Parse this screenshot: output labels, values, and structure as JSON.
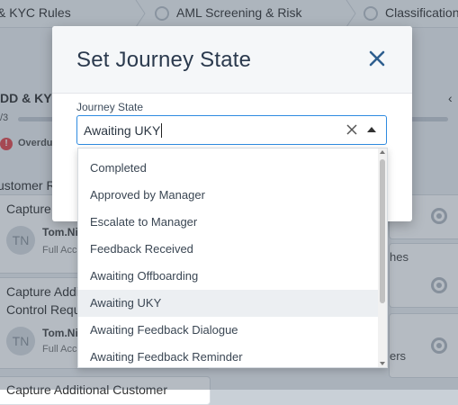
{
  "steps": [
    {
      "label": "& KYC Rules"
    },
    {
      "label": "AML Screening & Risk"
    },
    {
      "label": "Classification"
    }
  ],
  "background": {
    "section_title": "DD & KYC",
    "progress_text": "/3",
    "overdue_label": "Overdue",
    "group_title": "ustomer R",
    "cards": [
      {
        "title_line1": "Capture",
        "title_line2": "",
        "initials": "TN",
        "user_name": "Tom.Ni",
        "user_role": "Full Acc"
      },
      {
        "title_line1": "Capture Addi",
        "title_line2": "Control Requ",
        "initials": "TN",
        "user_name": "Tom.Ni",
        "user_role": "Full Acc"
      },
      {
        "title_line1": "Capture Additional Customer",
        "title_line2": "",
        "initials": "",
        "user_name": "",
        "user_role": ""
      }
    ],
    "right_labels": [
      "hes",
      "ers"
    ],
    "right_chevron": "‹"
  },
  "modal": {
    "title": "Set Journey State",
    "field_label": "Journey State",
    "input_value": "Awaiting UKY"
  },
  "dropdown": {
    "options": [
      "Completed",
      "Approved by Manager",
      "Escalate to Manager",
      "Feedback Received",
      "Awaiting Offboarding",
      "Awaiting UKY",
      "Awaiting Feedback Dialogue",
      "Awaiting Feedback Reminder"
    ],
    "selected": "Awaiting UKY"
  },
  "colors": {
    "accent": "#2f8be0",
    "title": "#2b3a4e",
    "overdue": "#e5484d"
  },
  "icons": {
    "close": "close-icon",
    "clear": "clear-x-icon",
    "arrow": "chevron-up-icon"
  }
}
